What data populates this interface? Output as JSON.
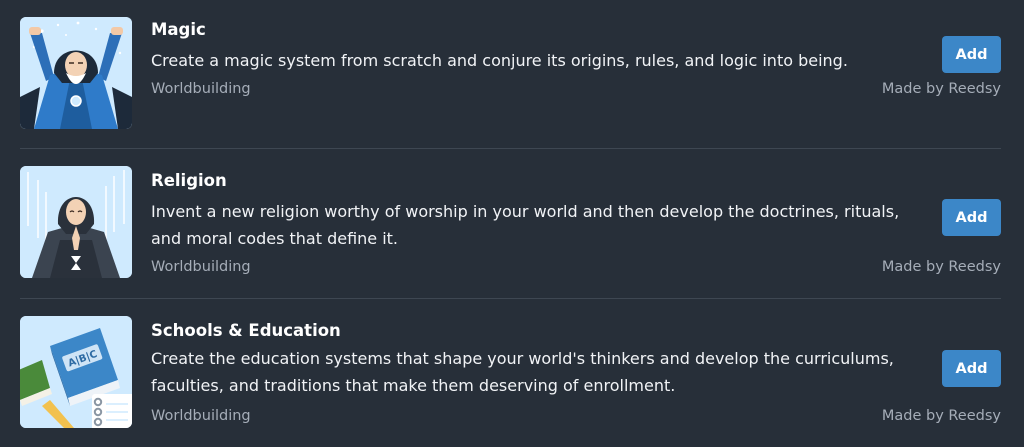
{
  "items": [
    {
      "title": "Magic",
      "description": "Create a magic system from scratch and conjure its origins, rules, and logic into being.",
      "category": "Worldbuilding",
      "maker": "Made by Reedsy",
      "button_label": "Add",
      "thumbnail_icon": "sorcerer-illustration"
    },
    {
      "title": "Religion",
      "description": "Invent a new religion worthy of worship in your world and then develop the doctrines, rituals, and moral codes that define it.",
      "category": "Worldbuilding",
      "maker": "Made by Reedsy",
      "button_label": "Add",
      "thumbnail_icon": "praying-monk-illustration"
    },
    {
      "title": "Schools & Education",
      "description": "Create the education systems that shape your world's thinkers and develop the curriculums, faculties, and traditions that make them deserving of enrollment.",
      "category": "Worldbuilding",
      "maker": "Made by Reedsy",
      "button_label": "Add",
      "thumbnail_icon": "abc-book-illustration",
      "book_text": "A|B|C"
    }
  ],
  "colors": {
    "background": "#272f39",
    "accent_button": "#3c87c8",
    "muted_text": "#a5adb8"
  }
}
